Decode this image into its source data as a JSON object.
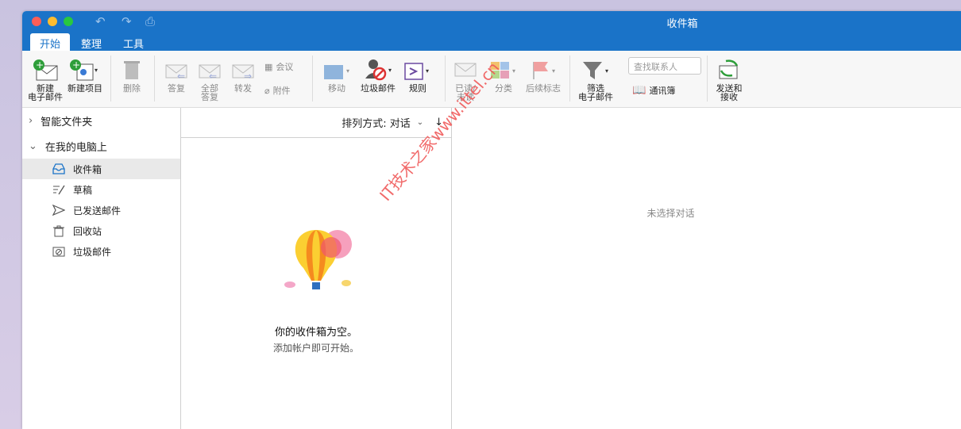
{
  "window": {
    "title": "收件箱"
  },
  "tabs": [
    {
      "label": "开始",
      "active": true
    },
    {
      "label": "整理",
      "active": false
    },
    {
      "label": "工具",
      "active": false
    }
  ],
  "ribbon": {
    "new_email": "新建\n电子邮件",
    "new_item": "新建项目",
    "delete": "删除",
    "reply": "答复",
    "reply_all": "全部\n答复",
    "forward": "转发",
    "meeting": "会议",
    "attachment": "附件",
    "move": "移动",
    "junk": "垃圾邮件",
    "rules": "规则",
    "read_unread": "已读/\n未读",
    "categorize": "分类",
    "follow_up": "后续标志",
    "filter_email": "筛选\n电子邮件",
    "search_contacts_placeholder": "查找联系人",
    "address_book": "通讯簿",
    "send_receive": "发送和\n接收"
  },
  "sidebar": {
    "smart_folders": "智能文件夹",
    "on_my_computer": "在我的电脑上",
    "items": [
      {
        "label": "收件箱",
        "icon": "inbox-icon",
        "active": true
      },
      {
        "label": "草稿",
        "icon": "draft-icon",
        "active": false
      },
      {
        "label": "已发送邮件",
        "icon": "sent-icon",
        "active": false
      },
      {
        "label": "回收站",
        "icon": "trash-icon",
        "active": false
      },
      {
        "label": "垃圾邮件",
        "icon": "junk-icon",
        "active": false
      }
    ]
  },
  "message_list": {
    "sort_label": "排列方式: 对话",
    "empty_title": "你的收件箱为空。",
    "empty_subtitle": "添加帐户即可开始。"
  },
  "reading_pane": {
    "no_selection": "未选择对话"
  },
  "watermark": "IT技术之家www.ittel.cn",
  "colors": {
    "accent": "#1a73c8",
    "watermark": "#f05a5a"
  }
}
